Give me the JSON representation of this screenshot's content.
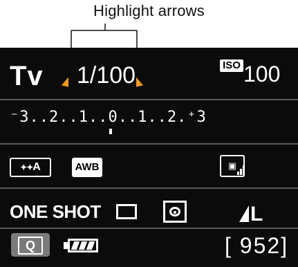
{
  "annotation": {
    "label": "Highlight arrows"
  },
  "screen": {
    "mode": "Tv",
    "shutter_speed": "1/100",
    "iso_badge": "ISO",
    "iso_value": "100",
    "exposure_scale": "⁻3..2..1..0..1..2.⁺3",
    "picture_style": "A",
    "white_balance": "AWB",
    "af_mode": "ONE SHOT",
    "quality": "L",
    "quick_button": "Q",
    "shots_remaining": "[ 952]"
  },
  "colors": {
    "highlight_arrow": "#f59a1e",
    "screen_bg": "#0b0b0b",
    "divider": "#5a5a5a",
    "quick_button_bg": "#7a7a7a"
  },
  "icons": [
    "picture-style-icon",
    "white-balance-icon",
    "auto-lighting-optimizer-icon",
    "drive-single-icon",
    "metering-evaluative-icon",
    "quality-large-icon",
    "battery-icon"
  ]
}
